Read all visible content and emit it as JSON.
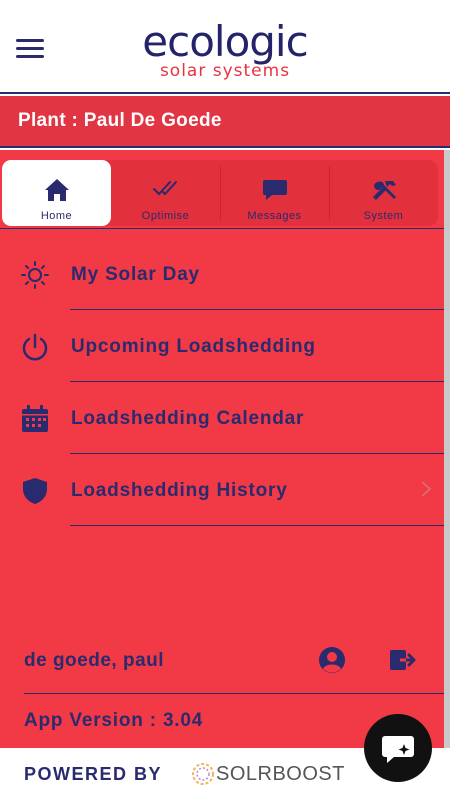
{
  "header": {
    "logo_main": "ecologic",
    "logo_sub": "solar systems",
    "plant_title": "Plant : Paul De Goede"
  },
  "tabs": [
    {
      "label": "Home",
      "icon": "home-icon",
      "active": true
    },
    {
      "label": "Optimise",
      "icon": "double-check-icon",
      "active": false
    },
    {
      "label": "Messages",
      "icon": "chat-bubble-icon",
      "active": false
    },
    {
      "label": "System",
      "icon": "tools-icon",
      "active": false
    }
  ],
  "menu": [
    {
      "label": "My Solar Day",
      "icon": "sun-icon"
    },
    {
      "label": "Upcoming Loadshedding",
      "icon": "power-icon"
    },
    {
      "label": "Loadshedding Calendar",
      "icon": "calendar-icon"
    },
    {
      "label": "Loadshedding History",
      "icon": "shield-icon"
    }
  ],
  "user": {
    "name": "de goede, paul"
  },
  "app": {
    "version_text": "App Version : 3.04"
  },
  "footer": {
    "powered_by": "POWERED BY",
    "brand": "SOLRBOOST"
  },
  "colors": {
    "primary_red": "#f13a46",
    "dark_red": "#e23543",
    "navy": "#2a2a6e"
  }
}
